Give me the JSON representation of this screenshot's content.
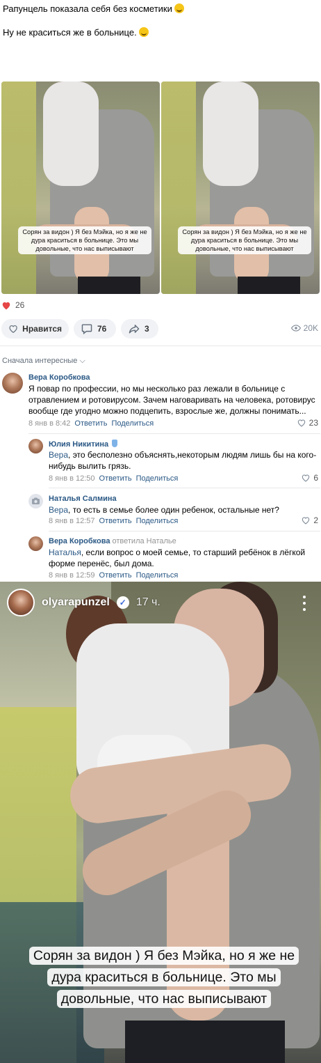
{
  "post": {
    "line1": "Рапунцель показала себя без косметики",
    "line2": "Ну не краситься же в больнице.",
    "photo_caption": "Сорян за видон ) Я без Мэйка, но я же не дура краситься в больнице. Это мы довольные, что нас выписывают",
    "likes_count": "26",
    "like_label": "Нравится",
    "comments_count": "76",
    "shares_count": "3",
    "views": "20K"
  },
  "sort_label": "Сначала интересные",
  "comments": [
    {
      "author": "Вера Коробкова",
      "text": "Я повар по профессии, но мы несколько раз лежали в больнице с отравлением и ротовирусом. Зачем наговаривать на человека, ротовирус вообще где угодно можно подцепить, взрослые же, должны понимать...",
      "date": "8 янв в 8:42",
      "reply": "Ответить",
      "share": "Поделиться",
      "likes": "23"
    },
    {
      "author": "Юлия Никитина",
      "addressee": "Вера",
      "text": ", это бесполезно объяснять,некоторым людям лишь бы на кого-нибудь вылить грязь.",
      "date": "8 янв в 12:50",
      "reply": "Ответить",
      "share": "Поделиться",
      "likes": "6"
    },
    {
      "author": "Наталья Салмина",
      "addressee": "Вера",
      "text": ", то есть в семье более один ребенок, остальные нет?",
      "date": "8 янв в 12:57",
      "reply": "Ответить",
      "share": "Поделиться",
      "likes": "2"
    },
    {
      "author": "Вера Коробкова",
      "replied_to": "ответила Наталье",
      "addressee": "Наталья",
      "text": ", если вопрос о моей семье, то старший ребёнок в лёгкой форме перенёс, был дома.",
      "date": "8 янв в 12:59",
      "reply": "Ответить",
      "share": "Поделиться"
    }
  ],
  "story": {
    "username": "olyarapunzel",
    "time": "17 ч.",
    "tshirt": "A",
    "caption": "Сорян за видон ) Я без Мэйка, но я же не дура краситься в больнице. Это мы довольные, что нас выписывают"
  }
}
